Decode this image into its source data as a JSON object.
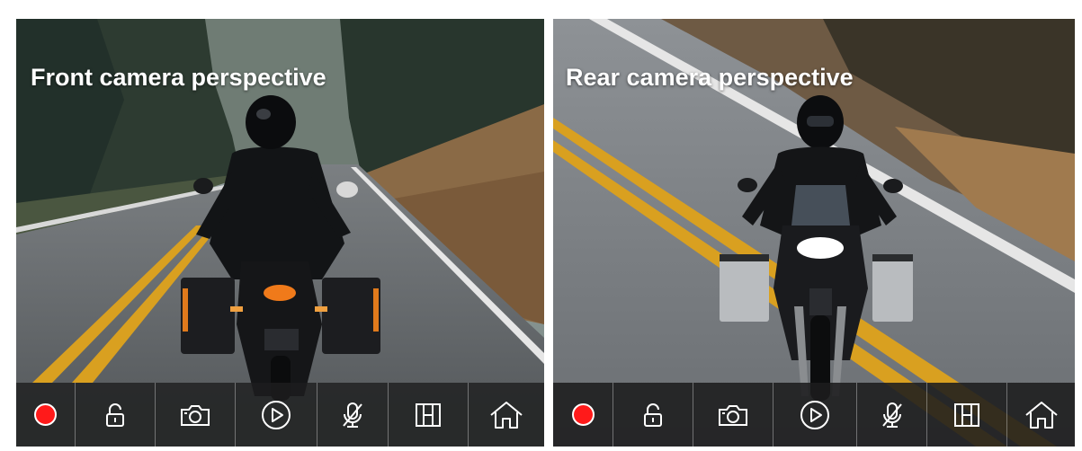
{
  "screen": {
    "front": {
      "title": "Front camera perspective",
      "toolbar": [
        {
          "icon": "record-icon",
          "role": "record"
        },
        {
          "icon": "unlock-icon",
          "role": "lock"
        },
        {
          "icon": "camera-icon",
          "role": "snapshot"
        },
        {
          "icon": "play-icon",
          "role": "playback"
        },
        {
          "icon": "mic-off-icon",
          "role": "microphone"
        },
        {
          "icon": "split-view-icon",
          "role": "view-switch"
        },
        {
          "icon": "home-icon",
          "role": "home"
        }
      ]
    },
    "rear": {
      "title": "Rear camera perspective",
      "toolbar": [
        {
          "icon": "record-icon",
          "role": "record"
        },
        {
          "icon": "unlock-icon",
          "role": "lock"
        },
        {
          "icon": "camera-icon",
          "role": "snapshot"
        },
        {
          "icon": "play-icon",
          "role": "playback"
        },
        {
          "icon": "mic-off-icon",
          "role": "microphone"
        },
        {
          "icon": "split-view-icon",
          "role": "view-switch"
        },
        {
          "icon": "home-icon",
          "role": "home"
        }
      ]
    }
  },
  "colors": {
    "record": "#ff1a1a",
    "toolbar_bg": "#1c1c1e",
    "road_line": "#e0a81f",
    "icon": "#ffffff"
  }
}
